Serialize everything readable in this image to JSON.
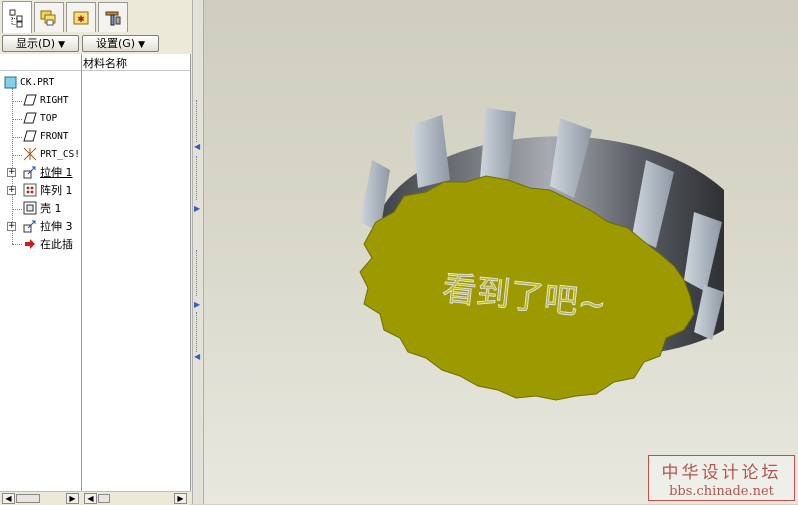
{
  "toolbar": {
    "display_label": "显示(D)",
    "settings_label": "设置(G)"
  },
  "columns": {
    "name_header": "",
    "material_header": "材料名称"
  },
  "tree": {
    "items": [
      {
        "label": "CK.PRT",
        "icon": "part-icon"
      },
      {
        "label": "RIGHT",
        "icon": "datum-plane-icon"
      },
      {
        "label": "TOP",
        "icon": "datum-plane-icon"
      },
      {
        "label": "FRONT",
        "icon": "datum-plane-icon"
      },
      {
        "label": "PRT_CS!",
        "icon": "coordinate-system-icon"
      },
      {
        "label": "拉伸 1",
        "icon": "extrude-icon"
      },
      {
        "label": "阵列 1",
        "icon": "pattern-icon"
      },
      {
        "label": "壳 1",
        "icon": "shell-icon"
      },
      {
        "label": "拉伸 3",
        "icon": "extrude-icon"
      },
      {
        "label": "在此插",
        "icon": "insert-here-arrow-icon"
      }
    ]
  },
  "model": {
    "embossed_text": "看到了吧~",
    "face_color": "#9c9a00",
    "wall_color": "#7a7e84"
  },
  "watermark": {
    "line1": "中华设计论坛",
    "line2": "bbs.chinade.net"
  }
}
